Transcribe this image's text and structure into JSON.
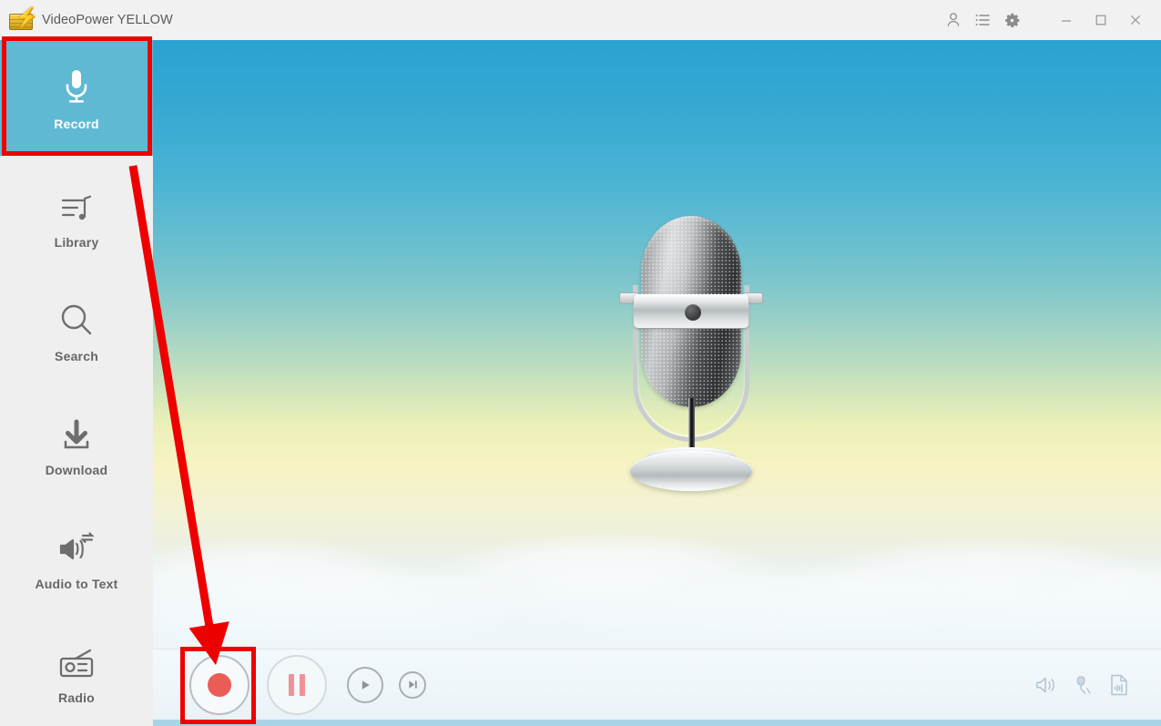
{
  "window": {
    "title": "VideoPower YELLOW",
    "logo_icon": "film-reel-lightning-icon",
    "titlebar_icons": [
      {
        "name": "account-icon",
        "label": "Account"
      },
      {
        "name": "task-list-icon",
        "label": "Task List"
      },
      {
        "name": "gear-icon",
        "label": "Settings"
      }
    ],
    "controls": [
      {
        "name": "minimize-button",
        "label": "Minimize"
      },
      {
        "name": "maximize-button",
        "label": "Maximize"
      },
      {
        "name": "close-button",
        "label": "Close"
      }
    ]
  },
  "sidebar": {
    "items": [
      {
        "label": "Record",
        "icon": "microphone-icon",
        "active": true
      },
      {
        "label": "Library",
        "icon": "music-list-icon",
        "active": false
      },
      {
        "label": "Search",
        "icon": "magnifier-icon",
        "active": false
      },
      {
        "label": "Download",
        "icon": "download-arrow-icon",
        "active": false
      },
      {
        "label": "Audio to Text",
        "icon": "audio-to-text-icon",
        "active": false
      },
      {
        "label": "Radio",
        "icon": "radio-icon",
        "active": false
      }
    ]
  },
  "stage": {
    "artwork": "retro-microphone-illustration",
    "background": "sky-gradient-with-clouds"
  },
  "player": {
    "buttons": [
      {
        "label": "Record",
        "icon": "record-dot-icon"
      },
      {
        "label": "Pause",
        "icon": "pause-bars-icon"
      },
      {
        "label": "Play",
        "icon": "play-triangle-icon"
      },
      {
        "label": "Next",
        "icon": "skip-next-icon"
      }
    ],
    "right_icons": [
      {
        "label": "Volume",
        "icon": "speaker-icon"
      },
      {
        "label": "Audio Source",
        "icon": "microphone-plug-icon"
      },
      {
        "label": "Output File",
        "icon": "audio-file-icon"
      }
    ]
  },
  "annotations": {
    "highlight_color": "#ee0000",
    "boxes": [
      {
        "target": "sidebar-item-record"
      },
      {
        "target": "player-record-button"
      }
    ],
    "arrow": {
      "from": "sidebar-item-record",
      "to": "player-record-button"
    }
  },
  "colors": {
    "accent": "#60b9d2",
    "record_red": "#ec5c57",
    "pause_pink": "#f19193",
    "sidebar_bg": "#efefef",
    "titlebar_bg": "#f1f1f1",
    "playerbar_bg": "#eff6fa",
    "bottom_strip": "#a8d4e6"
  }
}
